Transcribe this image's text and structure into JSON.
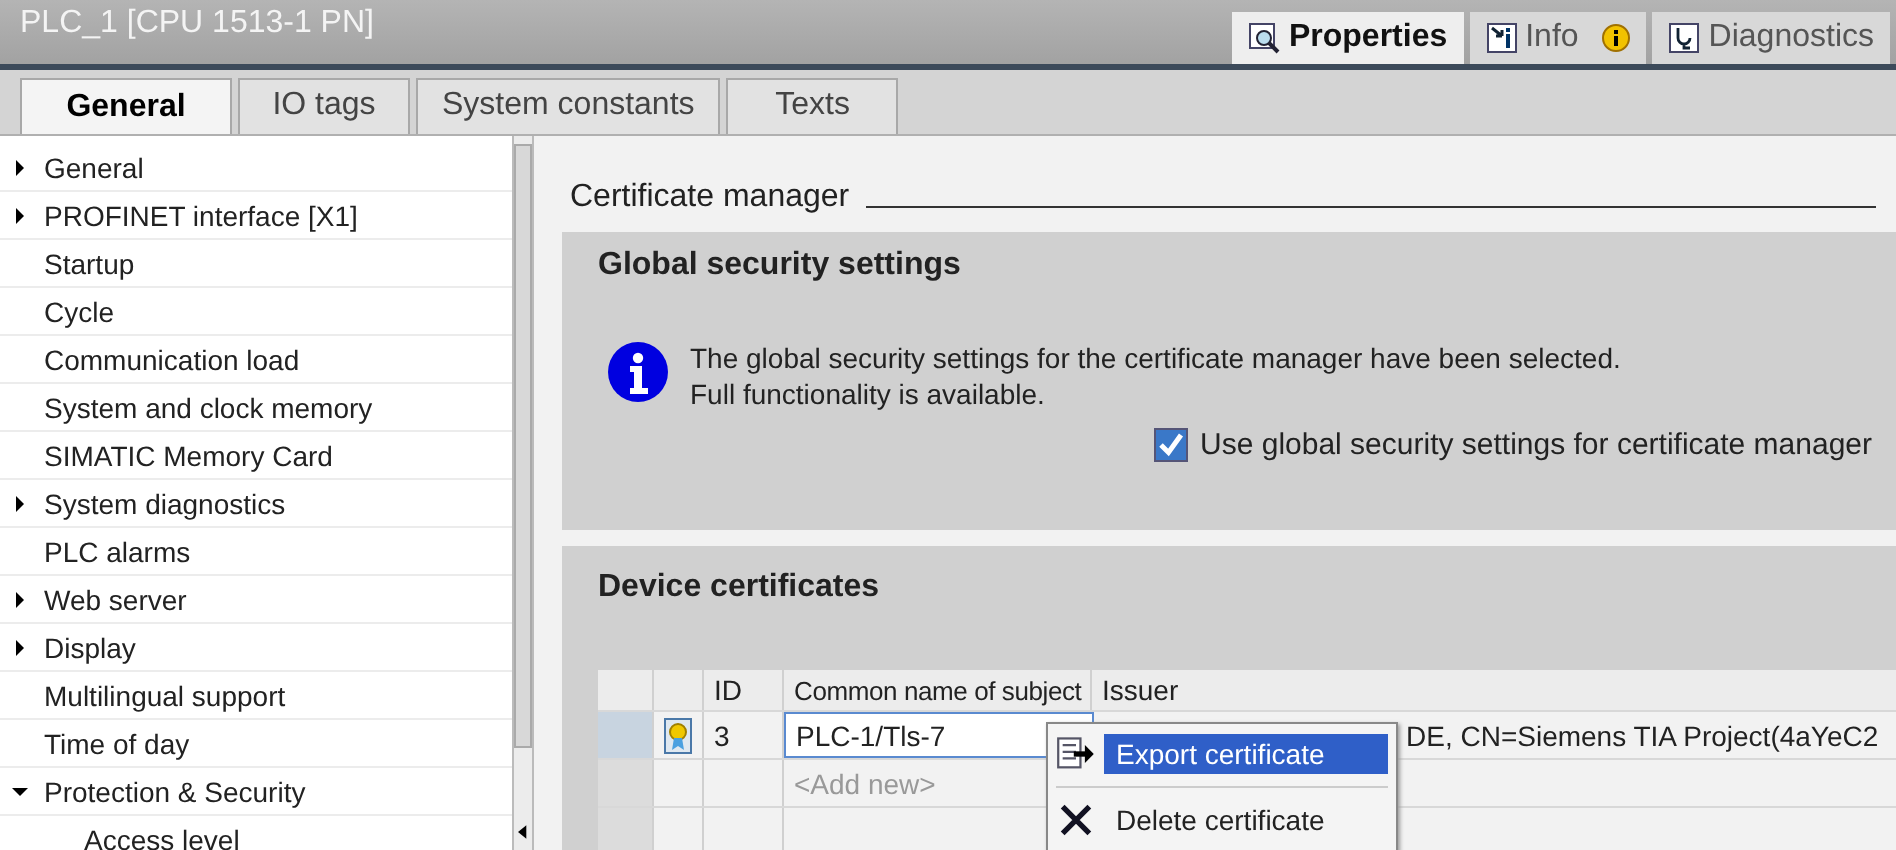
{
  "window": {
    "title": "PLC_1 [CPU 1513-1 PN]"
  },
  "view_tabs": [
    {
      "label": "Properties",
      "kind": "properties",
      "selected": true
    },
    {
      "label": "Info",
      "kind": "info",
      "selected": false
    },
    {
      "label": "Diagnostics",
      "kind": "diagnostics",
      "selected": false
    }
  ],
  "tabs": [
    {
      "label": "General",
      "selected": true
    },
    {
      "label": "IO tags",
      "selected": false
    },
    {
      "label": "System constants",
      "selected": false
    },
    {
      "label": "Texts",
      "selected": false
    }
  ],
  "sidebar": {
    "items": [
      {
        "label": "General",
        "expanded": false
      },
      {
        "label": "PROFINET interface [X1]",
        "expanded": false
      },
      {
        "label": "Startup"
      },
      {
        "label": "Cycle"
      },
      {
        "label": "Communication load"
      },
      {
        "label": "System and clock memory"
      },
      {
        "label": "SIMATIC Memory Card"
      },
      {
        "label": "System diagnostics",
        "expanded": false
      },
      {
        "label": "PLC alarms"
      },
      {
        "label": "Web server",
        "expanded": false
      },
      {
        "label": "Display",
        "expanded": false
      },
      {
        "label": "Multilingual support"
      },
      {
        "label": "Time of day"
      },
      {
        "label": "Protection & Security",
        "expanded": true,
        "children": [
          {
            "label": "Access level"
          }
        ]
      }
    ]
  },
  "section_title": "Certificate manager",
  "global_settings": {
    "title": "Global security settings",
    "message": "The global security settings for the certificate manager have been selected.\nFull functionality is available.",
    "checkbox": {
      "label": "Use global security settings for certificate manager",
      "checked": true
    }
  },
  "device_certificates": {
    "title": "Device certificates",
    "table": {
      "columns": [
        "ID",
        "Common name of subject",
        "Issuer"
      ],
      "rows": [
        {
          "id": "3",
          "name": "PLC-1/Tls-7",
          "issuer": "DE, CN=Siemens TIA Project(4aYeC2"
        }
      ],
      "add_new": "<Add new>"
    }
  },
  "context_menu": {
    "items": [
      {
        "label": "Export certificate",
        "kind": "export",
        "selected": true
      },
      {
        "label": "Delete certificate",
        "kind": "delete",
        "selected": false
      }
    ]
  }
}
